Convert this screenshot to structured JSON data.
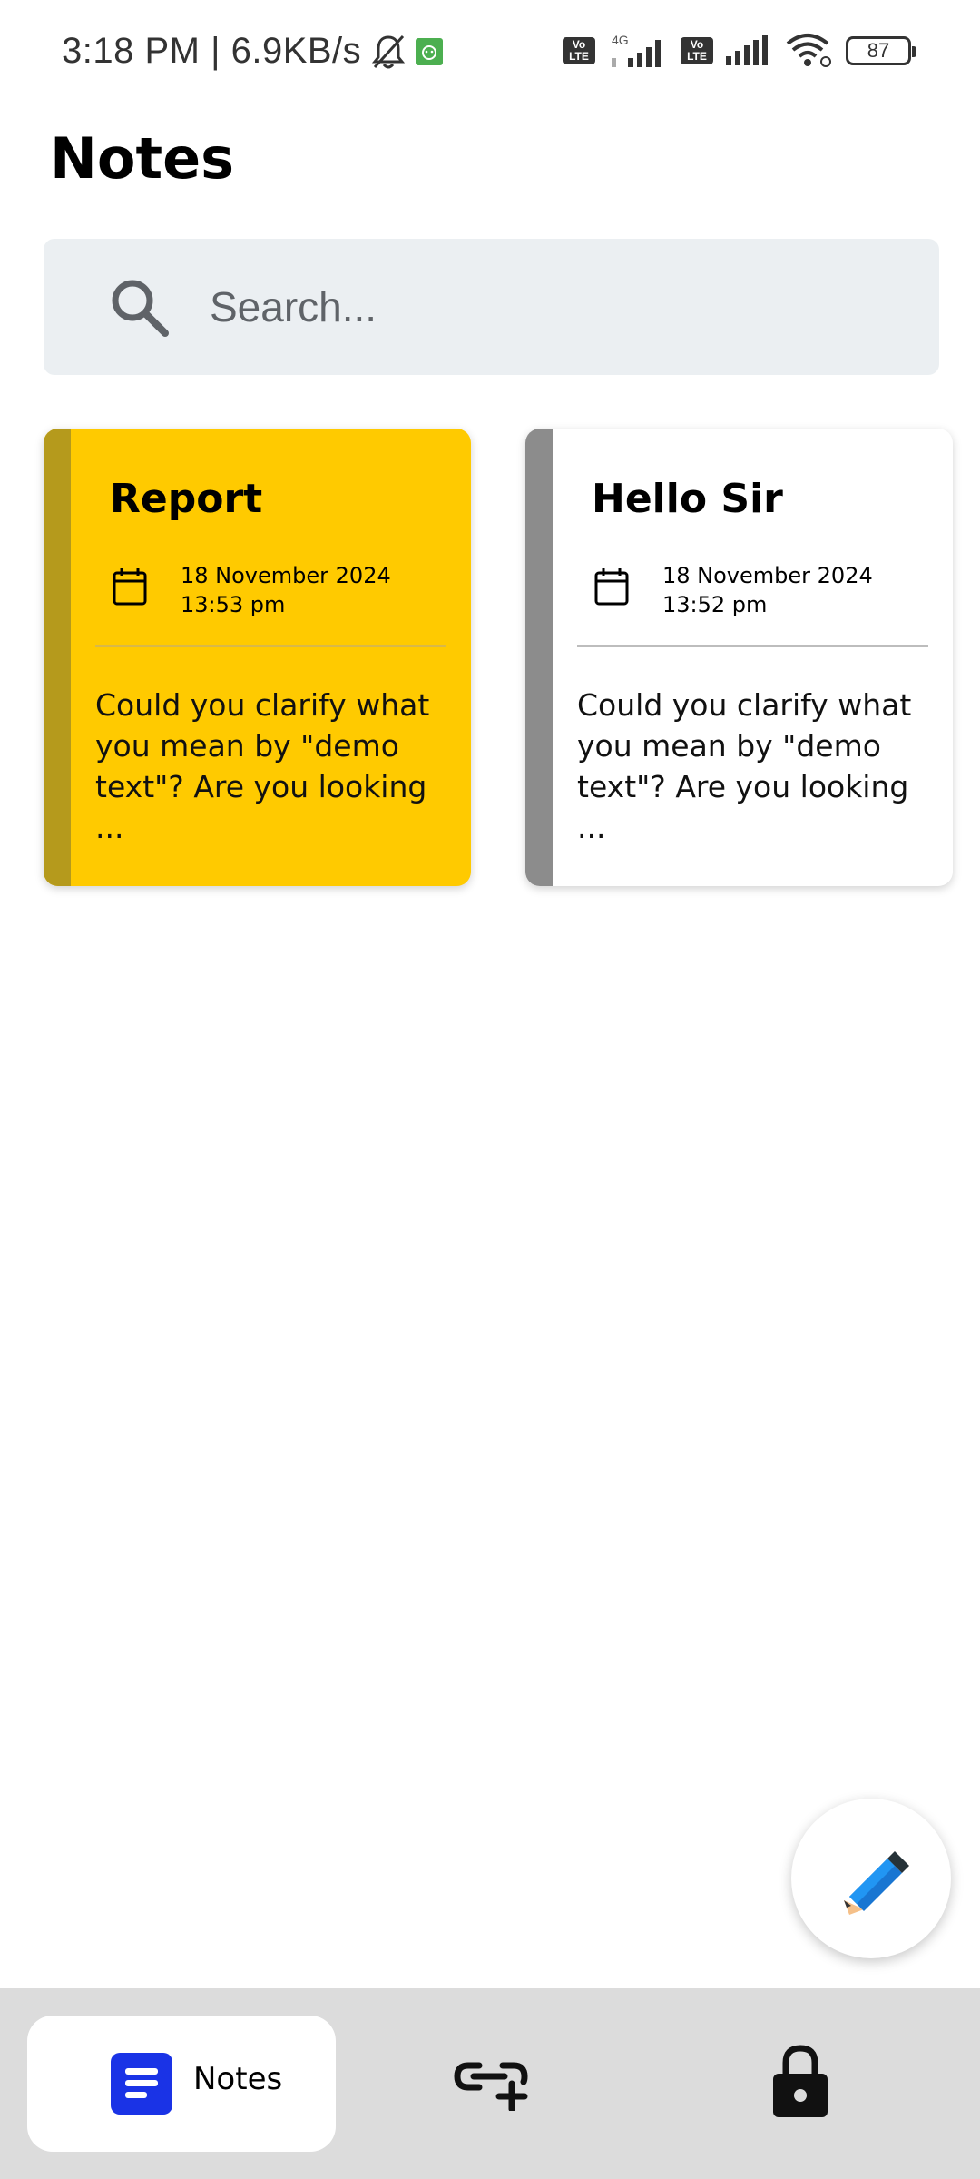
{
  "status_bar": {
    "time_speed": "3:18 PM | 6.9KB/s",
    "network_label": "4G",
    "volte_label": "Vo\nLTE",
    "battery": "87"
  },
  "header": {
    "title": "Notes"
  },
  "search": {
    "placeholder": "Search..."
  },
  "notes": [
    {
      "title": "Report",
      "date": "18 November 2024",
      "time": "13:53 pm",
      "preview": "Could you clarify what you mean by \"demo text\"? Are you looking ...",
      "color": "#ffca00",
      "stripe_color": "#b59a1c"
    },
    {
      "title": "Hello Sir",
      "date": "18 November 2024",
      "time": "13:52 pm",
      "preview": "Could you clarify what you mean by \"demo text\"? Are you looking ...",
      "color": "#ffffff",
      "stripe_color": "#8c8c8c"
    }
  ],
  "fab": {
    "icon": "pencil-icon"
  },
  "bottom_nav": {
    "items": [
      {
        "label": "Notes",
        "icon": "notes-icon",
        "active": true
      },
      {
        "label": "",
        "icon": "add-link-icon",
        "active": false
      },
      {
        "label": "",
        "icon": "lock-icon",
        "active": false
      }
    ]
  },
  "colors": {
    "accent": "#1a33e6",
    "search_bg": "#ebeff2",
    "nav_bg": "#dcdcdc"
  }
}
